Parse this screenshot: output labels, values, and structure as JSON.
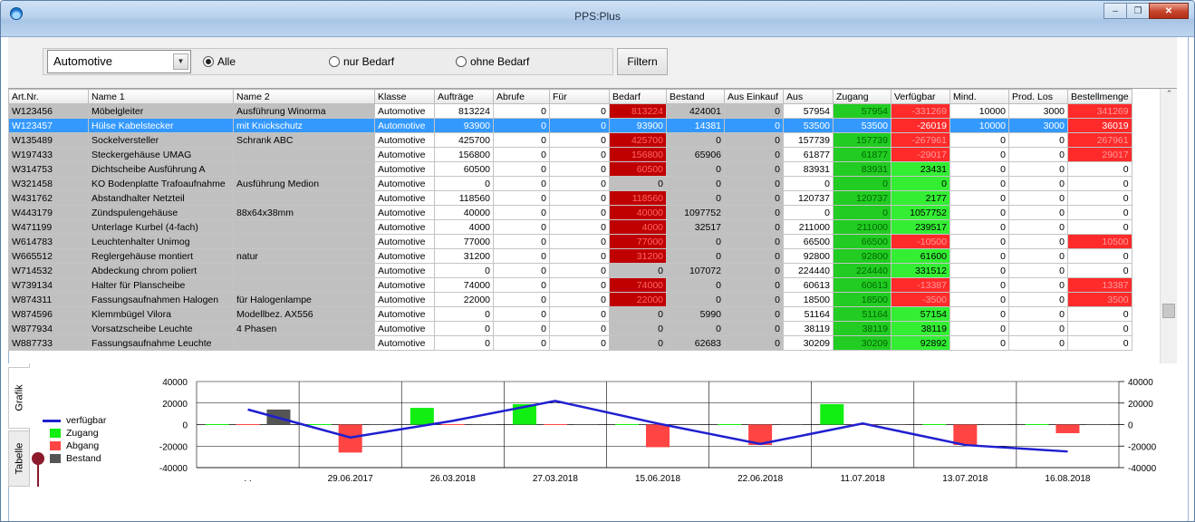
{
  "window": {
    "title": "PPS:Plus"
  },
  "filter": {
    "category_selected": "Automotive",
    "radio_all": "Alle",
    "radio_need": "nur Bedarf",
    "radio_noneed": "ohne Bedarf",
    "button": "Filtern",
    "selected_radio": "Alle"
  },
  "grid": {
    "columns": [
      "Art.Nr.",
      "Name 1",
      "Name 2",
      "Klasse",
      "Aufträge",
      "Abrufe",
      "Für",
      "Bedarf",
      "Bestand",
      "Aus Einkauf",
      "Aus",
      "Zugang",
      "Verfügbar",
      "Mind.",
      "Prod. Los",
      "Bestellmenge"
    ],
    "rows": [
      [
        "W123456",
        "Möbelgleiter",
        "Ausführung Winorma",
        "Automotive",
        "813224",
        "0",
        "0",
        "813224",
        "424001",
        "0",
        "57954",
        "57954",
        "-331269",
        "10000",
        "3000",
        "341269"
      ],
      [
        "W123457",
        "Hülse Kabelstecker",
        "mit Knickschutz",
        "Automotive",
        "93900",
        "0",
        "0",
        "93900",
        "14381",
        "0",
        "53500",
        "53500",
        "-26019",
        "10000",
        "3000",
        "36019"
      ],
      [
        "W135489",
        "Sockelversteller",
        "Schrank ABC",
        "Automotive",
        "425700",
        "0",
        "0",
        "425700",
        "0",
        "0",
        "157739",
        "157739",
        "-267961",
        "0",
        "0",
        "267961"
      ],
      [
        "W197433",
        "Steckergehäuse UMAG",
        "",
        "Automotive",
        "156800",
        "0",
        "0",
        "156800",
        "65906",
        "0",
        "61877",
        "61877",
        "-29017",
        "0",
        "0",
        "29017"
      ],
      [
        "W314753",
        "Dichtscheibe Ausführung A",
        "",
        "Automotive",
        "60500",
        "0",
        "0",
        "60500",
        "0",
        "0",
        "83931",
        "83931",
        "23431",
        "0",
        "0",
        "0"
      ],
      [
        "W321458",
        "KO Bodenplatte Trafoaufnahme",
        "Ausführung Medion",
        "Automotive",
        "0",
        "0",
        "0",
        "0",
        "0",
        "0",
        "0",
        "0",
        "0",
        "0",
        "0",
        "0"
      ],
      [
        "W431762",
        "Abstandhalter Netzteil",
        "",
        "Automotive",
        "118560",
        "0",
        "0",
        "118560",
        "0",
        "0",
        "120737",
        "120737",
        "2177",
        "0",
        "0",
        "0"
      ],
      [
        "W443179",
        "Zündspulengehäuse",
        "88x64x38mm",
        "Automotive",
        "40000",
        "0",
        "0",
        "40000",
        "1097752",
        "0",
        "0",
        "0",
        "1057752",
        "0",
        "0",
        "0"
      ],
      [
        "W471199",
        "Unterlage Kurbel (4-fach)",
        "",
        "Automotive",
        "4000",
        "0",
        "0",
        "4000",
        "32517",
        "0",
        "211000",
        "211000",
        "239517",
        "0",
        "0",
        "0"
      ],
      [
        "W614783",
        "Leuchtenhalter Unimog",
        "",
        "Automotive",
        "77000",
        "0",
        "0",
        "77000",
        "0",
        "0",
        "66500",
        "66500",
        "-10500",
        "0",
        "0",
        "10500"
      ],
      [
        "W665512",
        "Reglergehäuse montiert",
        "natur",
        "Automotive",
        "31200",
        "0",
        "0",
        "31200",
        "0",
        "0",
        "92800",
        "92800",
        "61600",
        "0",
        "0",
        "0"
      ],
      [
        "W714532",
        "Abdeckung chrom poliert",
        "",
        "Automotive",
        "0",
        "0",
        "0",
        "0",
        "107072",
        "0",
        "224440",
        "224440",
        "331512",
        "0",
        "0",
        "0"
      ],
      [
        "W739134",
        "Halter für Planscheibe",
        "",
        "Automotive",
        "74000",
        "0",
        "0",
        "74000",
        "0",
        "0",
        "60613",
        "60613",
        "-13387",
        "0",
        "0",
        "13387"
      ],
      [
        "W874311",
        "Fassungsaufnahmen Halogen",
        "für Halogenlampe",
        "Automotive",
        "22000",
        "0",
        "0",
        "22000",
        "0",
        "0",
        "18500",
        "18500",
        "-3500",
        "0",
        "0",
        "3500"
      ],
      [
        "W874596",
        "Klemmbügel Vilora",
        "Modellbez. AX556",
        "Automotive",
        "0",
        "0",
        "0",
        "0",
        "5990",
        "0",
        "51164",
        "51164",
        "57154",
        "0",
        "0",
        "0"
      ],
      [
        "W877934",
        "Vorsatzscheibe Leuchte",
        "4 Phasen",
        "Automotive",
        "0",
        "0",
        "0",
        "0",
        "0",
        "0",
        "38119",
        "38119",
        "38119",
        "0",
        "0",
        "0"
      ],
      [
        "W887733",
        "Fassungsaufnahme Leuchte",
        "",
        "Automotive",
        "0",
        "0",
        "0",
        "0",
        "62683",
        "0",
        "30209",
        "30209",
        "92892",
        "0",
        "0",
        "0"
      ]
    ],
    "selected_row": 1
  },
  "tabs": {
    "grafik": "Grafik",
    "tabelle": "Tabelle"
  },
  "legend": {
    "verfuegbar": "verfügbar",
    "zugang": "Zugang",
    "abgang": "Abgang",
    "bestand": "Bestand"
  },
  "colors": {
    "verfuegbar": "#1f1fd0",
    "zugang": "#11ee11",
    "abgang": "#ff4444",
    "bestand": "#555555"
  },
  "chart_data": {
    "type": "bar",
    "categories": [
      ". .",
      "29.06.2017",
      "26.03.2018",
      "27.03.2018",
      "15.06.2018",
      "22.06.2018",
      "11.07.2018",
      "13.07.2018",
      "16.08.2018"
    ],
    "ylim": [
      -40000,
      40000
    ],
    "yticks": [
      "40000",
      "20000",
      "0",
      "-20000",
      "-40000"
    ],
    "series": [
      {
        "name": "Zugang",
        "type": "bar",
        "values": [
          0,
          0,
          15500,
          19000,
          0,
          0,
          19000,
          0,
          0
        ]
      },
      {
        "name": "Abgang",
        "type": "bar",
        "values": [
          0,
          -26000,
          0,
          0,
          -21000,
          -19000,
          0,
          -19000,
          -8000
        ]
      },
      {
        "name": "Bestand",
        "type": "bar",
        "values": [
          14000,
          0,
          0,
          0,
          0,
          0,
          0,
          0,
          0
        ]
      },
      {
        "name": "verfügbar",
        "type": "line",
        "values": [
          14000,
          -12000,
          3500,
          22000,
          1000,
          -18000,
          1000,
          -19000,
          -25000
        ]
      }
    ]
  }
}
